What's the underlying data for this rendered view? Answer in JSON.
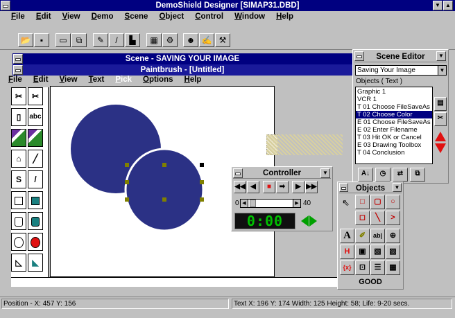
{
  "app": {
    "title": "DemoShield Designer [SIMAP31.DBD]",
    "menu": [
      "File",
      "Edit",
      "View",
      "Demo",
      "Scene",
      "Object",
      "Control",
      "Window",
      "Help"
    ]
  },
  "toolbar": {
    "icons": [
      "open-icon",
      "save-icon",
      "window-icon",
      "tile-icon",
      "edit-icon",
      "pen-icon",
      "chart-icon",
      "grid-icon",
      "settings-icon",
      "people-icon",
      "hand-edit-icon",
      "tool-icon"
    ]
  },
  "scene": {
    "title": "Scene - SAVING YOUR IMAGE"
  },
  "paint": {
    "title": "Paintbrush - [Untitled]",
    "menu": [
      "File",
      "Edit",
      "View",
      "Text",
      "Pick",
      "Options",
      "Help"
    ],
    "tools": [
      "scissors-icon",
      "scissors-select-icon",
      "spray-icon",
      "text-icon",
      "color-eraser-icon",
      "eraser-icon",
      "paint-roller-icon",
      "brush-icon",
      "curve-icon",
      "line-icon",
      "box-icon",
      "filled-box-icon",
      "rounded-box-icon",
      "filled-rounded-box-icon",
      "circle-icon",
      "filled-circle-icon",
      "polygon-icon",
      "filled-polygon-icon"
    ],
    "text_tool_label": "abc"
  },
  "editor": {
    "title": "Scene Editor",
    "selected_scene": "Saving Your Image",
    "objects_label": "Objects ( Text )",
    "objects": [
      "Graphic 1",
      "VCR 1",
      "T 01 Choose FileSaveAs",
      "T 02 Choose Color",
      "E 01 Choose FileSaveAs",
      "E 02 Enter Filename",
      "T 03 Hit OK or Cancel",
      "E 03 Drawing Toolbox",
      "T 04 Conclusion"
    ],
    "selected_index": 3
  },
  "controller": {
    "title": "Controller",
    "slider_min": "0",
    "slider_max": "40",
    "counter": "0:00"
  },
  "objects_palette": {
    "title": "Objects",
    "footer": "GOOD",
    "text_button": "A",
    "ab_button": "ab|",
    "h_button": "H",
    "var_button": "{x}"
  },
  "status": {
    "left": "Position - X: 457 Y: 156",
    "right": "Text X: 196 Y: 174 Width: 125 Height:  58; Life: 9-20 secs."
  },
  "colors": {
    "titlebar": "#000080",
    "ellipse": "#2b3185",
    "led": "#00c000",
    "red": "#e01010"
  }
}
